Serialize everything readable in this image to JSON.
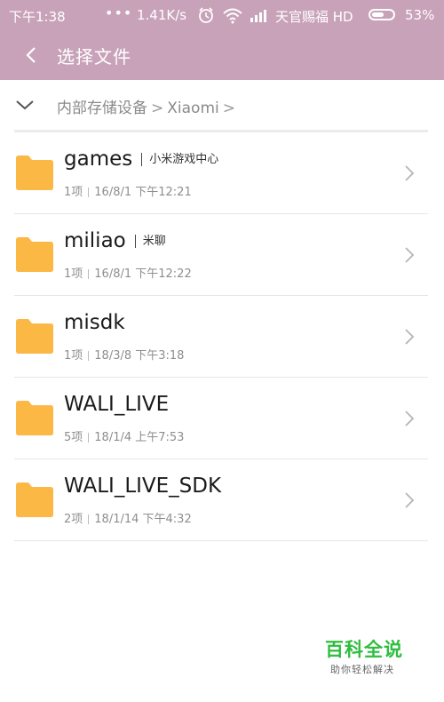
{
  "status_bar": {
    "time": "下午1:38",
    "dots": "•••",
    "speed": "1.41K/s",
    "carrier": "天官赐福 HD",
    "battery": "53%",
    "battery_level": 0.53
  },
  "header": {
    "title": "选择文件",
    "back_icon": "chevron-left-icon"
  },
  "breadcrumb": {
    "toggle_icon": "chevron-down-icon",
    "items": [
      "内部存储设备",
      "Xiaomi"
    ],
    "separator": ">"
  },
  "files": [
    {
      "name": "games",
      "alias": "小米游戏中心",
      "count": "1项",
      "date": "16/8/1 下午12:21"
    },
    {
      "name": "miliao",
      "alias": "米聊",
      "count": "1项",
      "date": "16/8/1 下午12:22"
    },
    {
      "name": "misdk",
      "alias": "",
      "count": "1项",
      "date": "18/3/8 下午3:18"
    },
    {
      "name": "WALI_LIVE",
      "alias": "",
      "count": "5项",
      "date": "18/1/4 上午7:53"
    },
    {
      "name": "WALI_LIVE_SDK",
      "alias": "",
      "count": "2项",
      "date": "18/1/14 下午4:32"
    }
  ],
  "watermark": {
    "title": "百科全说",
    "subtitle": "助你轻松解决"
  },
  "colors": {
    "accent": "#c8a2b9",
    "folder": "#fbb845",
    "watermark": "#2fbd3f"
  }
}
